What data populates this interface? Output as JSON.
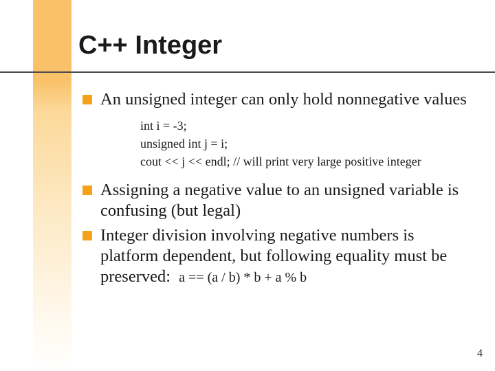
{
  "title": "C++ Integer",
  "bullets": {
    "b1": "An unsigned integer can only hold nonnegative values",
    "b2": "Assigning a negative value to an unsigned variable is confusing (but legal)",
    "b3_prefix": "Integer division involving negative numbers is platform dependent, but following equality must be preserved:  ",
    "b3_eq": "a == (a / b) * b + a % b"
  },
  "code": {
    "l1": "int i = -3;",
    "l2": "unsigned int j = i;",
    "l3": "cout << j << endl; // will print very large positive integer"
  },
  "page_number": "4"
}
